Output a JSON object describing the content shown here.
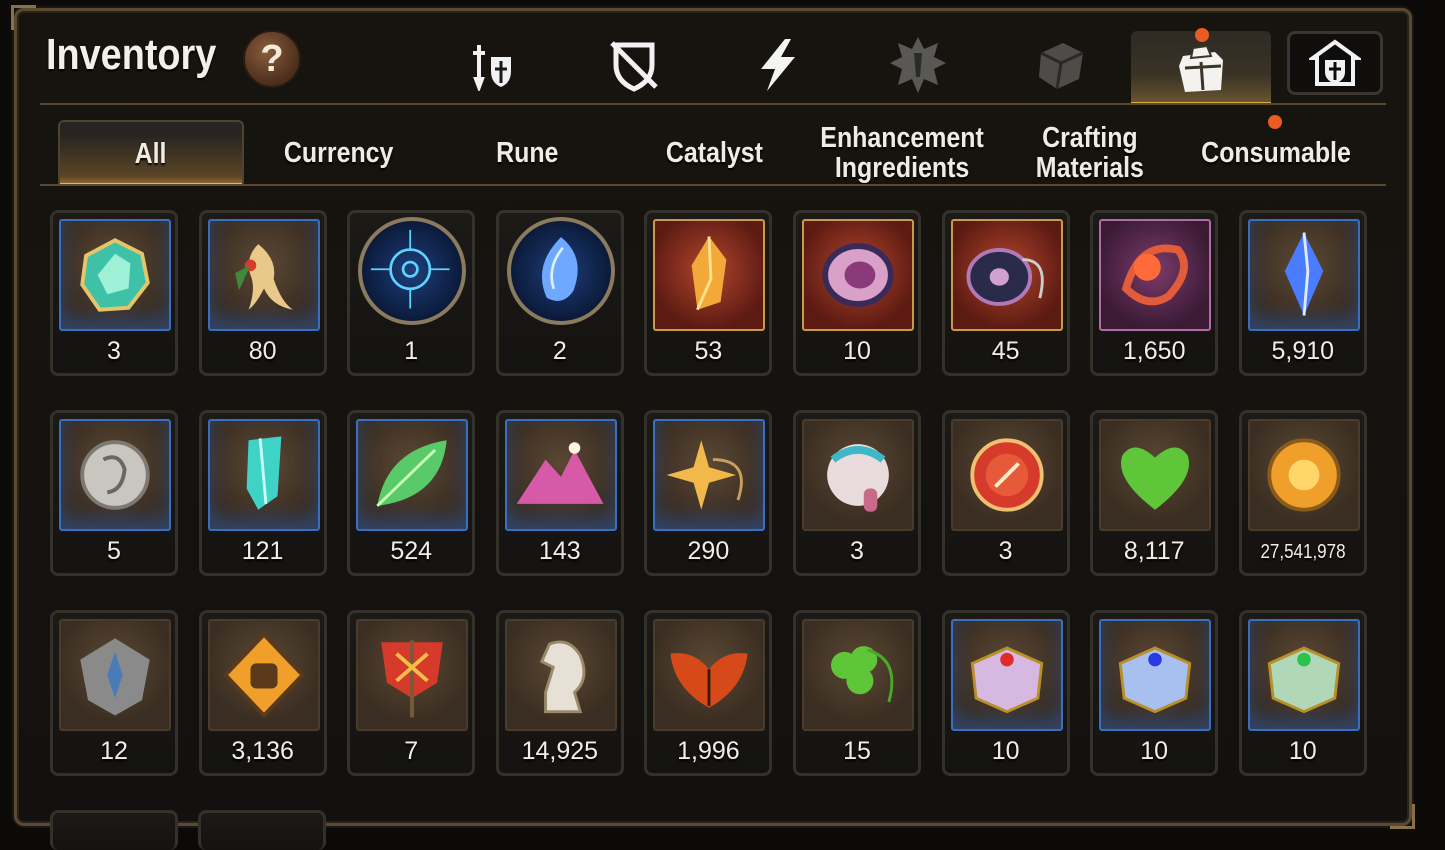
{
  "header": {
    "title": "Inventory",
    "help_label": "?"
  },
  "category_icons": [
    {
      "name": "attack-gear-icon"
    },
    {
      "name": "defense-gear-icon"
    },
    {
      "name": "skill-lightning-icon"
    },
    {
      "name": "artifact-icon"
    },
    {
      "name": "material-cube-icon"
    },
    {
      "name": "inventory-bag-icon",
      "active": true,
      "notification": true
    },
    {
      "name": "guild-shield-icon"
    }
  ],
  "tabs": [
    {
      "label": "All",
      "active": true
    },
    {
      "label": "Currency"
    },
    {
      "label": "Rune"
    },
    {
      "label": "Catalyst"
    },
    {
      "label": "Enhancement\nIngredients"
    },
    {
      "label": "Crafting\nMaterials"
    },
    {
      "label": "Consumable",
      "notification": true
    }
  ],
  "items": [
    {
      "icon": "teal-gem-icon",
      "count": "3"
    },
    {
      "icon": "ginseng-root-icon",
      "count": "80"
    },
    {
      "icon": "blue-rune-orb-icon",
      "count": "1"
    },
    {
      "icon": "crystal-orb-icon",
      "count": "2"
    },
    {
      "icon": "golden-crystal-icon",
      "count": "53"
    },
    {
      "icon": "pink-disc-icon",
      "count": "10"
    },
    {
      "icon": "dark-yoyo-icon",
      "count": "45"
    },
    {
      "icon": "red-flower-ring-icon",
      "count": "1,650"
    },
    {
      "icon": "blue-crystal-icon",
      "count": "5,910"
    },
    {
      "icon": "silver-coin-icon",
      "count": "5"
    },
    {
      "icon": "cyan-crystal-icon",
      "count": "121"
    },
    {
      "icon": "green-leaf-icon",
      "count": "524"
    },
    {
      "icon": "pink-mountain-icon",
      "count": "143"
    },
    {
      "icon": "star-pendant-icon",
      "count": "290"
    },
    {
      "icon": "pink-capsule-icon",
      "count": "3"
    },
    {
      "icon": "red-seal-icon",
      "count": "3"
    },
    {
      "icon": "green-heart-icon",
      "count": "8,117"
    },
    {
      "icon": "gold-sun-coin-icon",
      "count": "27,541,978"
    },
    {
      "icon": "stone-compass-icon",
      "count": "12"
    },
    {
      "icon": "fist-badge-icon",
      "count": "3,136"
    },
    {
      "icon": "red-banner-icon",
      "count": "7"
    },
    {
      "icon": "silver-knight-icon",
      "count": "14,925"
    },
    {
      "icon": "red-maple-leaf-icon",
      "count": "1,996"
    },
    {
      "icon": "clover-pendant-icon",
      "count": "15"
    },
    {
      "icon": "purple-chest-icon",
      "count": "10"
    },
    {
      "icon": "blue-chest-icon",
      "count": "10"
    },
    {
      "icon": "green-chest-icon",
      "count": "10"
    }
  ],
  "colors": {
    "accent_gold": "#d9a94a",
    "notification": "#ec5b22",
    "frame": "#5a4a33"
  }
}
